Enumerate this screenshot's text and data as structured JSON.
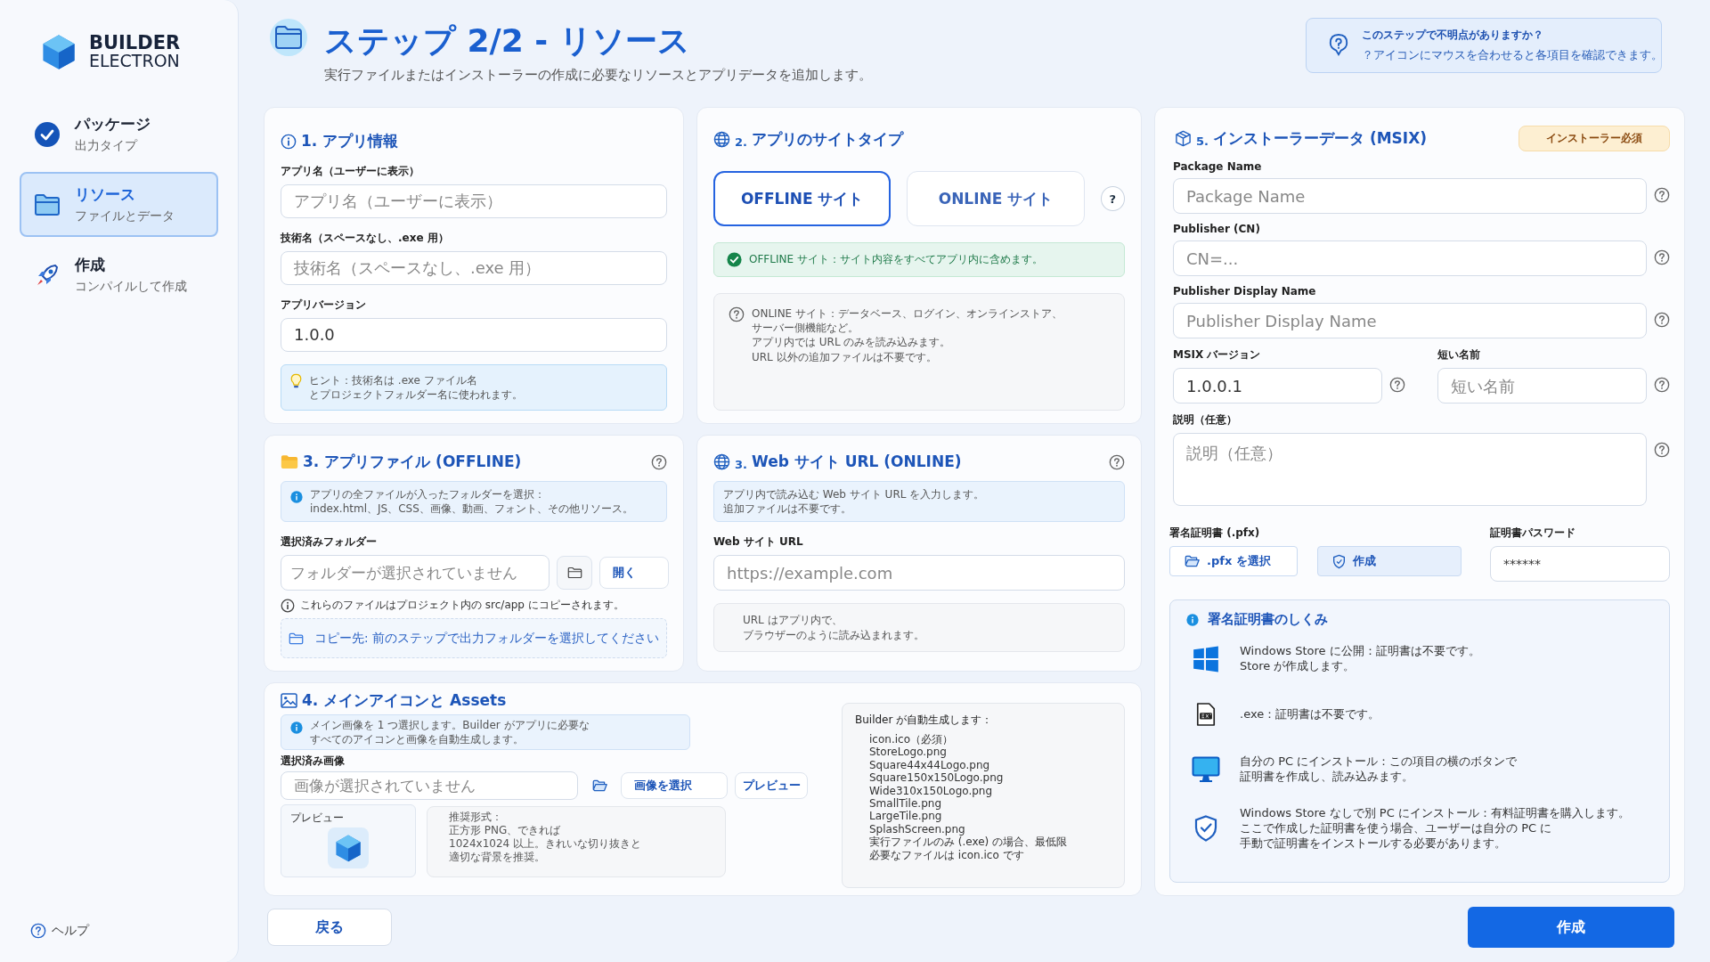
{
  "sidebar": {
    "logo": {
      "line1": "BUILDER",
      "line2": "ELECTRON"
    },
    "steps": [
      {
        "title": "パッケージ",
        "subtitle": "出力タイプ",
        "completed": true,
        "selected": false
      },
      {
        "title": "リソース",
        "subtitle": "ファイルとデータ",
        "completed": false,
        "selected": true
      },
      {
        "title": "作成",
        "subtitle": "コンパイルして作成",
        "completed": false,
        "selected": false
      }
    ],
    "help": "ヘルプ"
  },
  "header": {
    "title": "ステップ 2/2 - リソース",
    "subtitle": "実行ファイルまたはインストーラーの作成に必要なリソースとアプリデータを追加します。"
  },
  "help_box": {
    "title": "このステップで不明点がありますか？",
    "text": "？アイコンにマウスを合わせると各項目を確認できます。"
  },
  "app_info": {
    "title": "1. アプリ情報",
    "fields": [
      {
        "label": "アプリ名（ユーザーに表示）",
        "placeholder": "アプリ名（ユーザーに表示）"
      },
      {
        "label": "技術名（スペースなし、.exe 用）",
        "placeholder": "技術名（スペースなし、.exe 用）"
      },
      {
        "label": "アプリバージョン",
        "value": "1.0.0"
      }
    ],
    "hint": [
      "ヒント：技術名は .exe ファイル名",
      "とプロジェクトフォルダー名に使われます。"
    ]
  },
  "site_type": {
    "number": "2.",
    "title": "アプリのサイトタイプ",
    "options": [
      {
        "label": "OFFLINE サイト",
        "selected": true
      },
      {
        "label": "ONLINE サイト",
        "selected": false
      }
    ],
    "help_button": "?",
    "success_note": "OFFLINE サイト：サイト内容をすべてアプリ内に含めます。",
    "info_note": [
      "ONLINE サイト：データベース、ログイン、オンラインストア、",
      "サーバー側機能など。",
      "アプリ内では URL のみを読み込みます。",
      "URL 以外の追加ファイルは不要です。"
    ]
  },
  "app_files": {
    "title": "3. アプリファイル (OFFLINE)",
    "info": [
      "アプリの全ファイルが入ったフォルダーを選択：",
      "index.html、JS、CSS、画像、動画、フォント、その他リソース。"
    ],
    "label": "選択済みフォルダー",
    "placeholder": "フォルダーが選択されていません",
    "open_button": "開く",
    "note": "これらのファイルはプロジェクト内の src/app にコピーされます。",
    "destination": "コピー先: 前のステップで出力フォルダーを選択してください"
  },
  "web_url": {
    "number": "3.",
    "title": "Web サイト URL (ONLINE)",
    "info": [
      "アプリ内で読み込む Web サイト URL を入力します。",
      "追加ファイルは不要です。"
    ],
    "label": "Web サイト URL",
    "placeholder": "https://example.com",
    "note": [
      "URL はアプリ内で、",
      "ブラウザーのように読み込まれます。"
    ]
  },
  "icon_assets": {
    "title": "4. メインアイコンと Assets",
    "info": [
      "メイン画像を 1 つ選択します。Builder がアプリに必要な",
      "すべてのアイコンと画像を自動生成します。"
    ],
    "label": "選択済み画像",
    "placeholder": "画像が選択されていません",
    "buttons": [
      "画像を選択",
      "プレビュー"
    ],
    "preview_label": "プレビュー",
    "recommendation": [
      "推奨形式：",
      "正方形 PNG、できれば",
      "1024x1024 以上。きれいな切り抜きと",
      "適切な背景を推奨。"
    ],
    "generated_title": "Builder が自動生成します：",
    "generated_items": [
      "icon.ico（必須）",
      "StoreLogo.png",
      "Square44x44Logo.png",
      "Square150x150Logo.png",
      "Wide310x150Logo.png",
      "SmallTile.png",
      "LargeTile.png",
      "SplashScreen.png",
      "実行ファイルのみ (.exe) の場合、最低限",
      "必要なファイルは icon.ico です"
    ]
  },
  "installer": {
    "number": "5.",
    "title": "インストーラーデータ (MSIX)",
    "badge": "インストーラー必須",
    "fields": [
      {
        "label": "Package Name",
        "placeholder": "Package Name",
        "kind": "full"
      },
      {
        "label": "Publisher (CN)",
        "placeholder": "CN=...",
        "kind": "full"
      },
      {
        "label": "Publisher Display Name",
        "placeholder": "Publisher Display Name",
        "kind": "full"
      },
      {
        "label": "MSIX バージョン",
        "value": "1.0.0.1",
        "kind": "half"
      },
      {
        "label": "短い名前",
        "placeholder": "短い名前",
        "kind": "half"
      },
      {
        "label": "説明（任意）",
        "placeholder": "説明（任意）",
        "kind": "area"
      }
    ],
    "certificate": {
      "label": "署名証明書 (.pfx)",
      "select_button": ".pfx を選択",
      "create_button": "作成",
      "password_label": "証明書パスワード",
      "password_value": "******"
    },
    "how_title": "署名証明書のしくみ",
    "how_items": [
      {
        "kind": "windows",
        "text": [
          "Windows Store に公開：証明書は不要です。",
          "Store が作成します。"
        ]
      },
      {
        "kind": "exe",
        "text": [
          ".exe：証明書は不要です。"
        ]
      },
      {
        "kind": "pc",
        "text": [
          "自分の PC にインストール：この項目の横のボタンで",
          "証明書を作成し、読み込みます。"
        ]
      },
      {
        "kind": "shield",
        "text": [
          "Windows Store なしで別 PC にインストール：有料証明書を購入します。",
          "ここで作成した証明書を使う場合、ユーザーは自分の PC に",
          "手動で証明書をインストールする必要があります。"
        ]
      }
    ]
  },
  "footer": {
    "back_button": "戻る",
    "create_button": "作成"
  }
}
